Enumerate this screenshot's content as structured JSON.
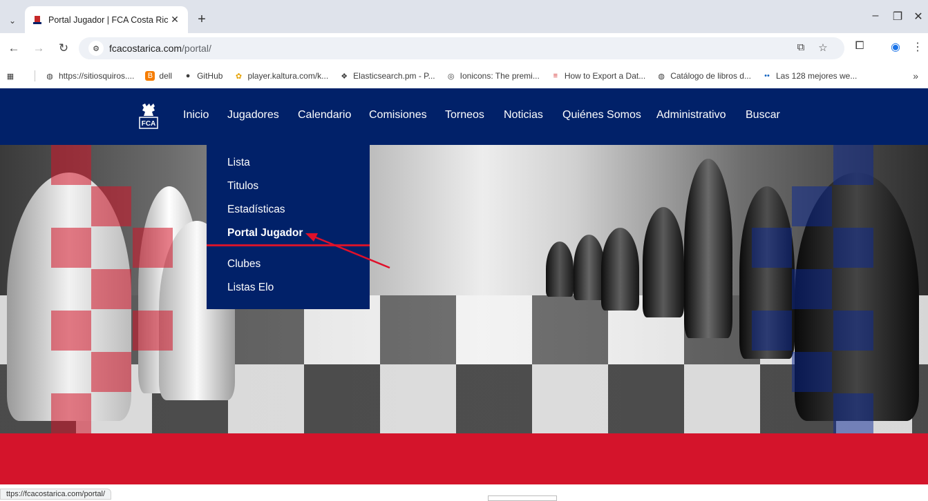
{
  "browser": {
    "tab_title": "Portal Jugador | FCA Costa Rica",
    "new_tab": "+",
    "tab_close": "✕",
    "url_host": "fcacostarica.com",
    "url_path": "/portal/",
    "status_url": "ttps://fcacostarica.com/portal/",
    "window_controls": [
      "–",
      "❐",
      "✕"
    ]
  },
  "bookmarks": [
    {
      "label": "https://sitiosquiros....",
      "icon": "globe-icon"
    },
    {
      "label": "dell",
      "icon": "blogger-icon"
    },
    {
      "label": "GitHub",
      "icon": "github-icon"
    },
    {
      "label": "player.kaltura.com/k...",
      "icon": "kaltura-icon"
    },
    {
      "label": "Elasticsearch.pm - P...",
      "icon": "elastic-icon"
    },
    {
      "label": "Ionicons: The premi...",
      "icon": "ionicons-icon"
    },
    {
      "label": "How to Export a Dat...",
      "icon": "flag-icon"
    },
    {
      "label": "Catálogo de libros d...",
      "icon": "globe-icon"
    },
    {
      "label": "Las 128 mejores we...",
      "icon": "dots-icon"
    }
  ],
  "site": {
    "nav": [
      "Inicio",
      "Jugadores",
      "Calendario",
      "Comisiones",
      "Torneos",
      "Noticias",
      "Quiénes Somos",
      "Administrativo",
      "Buscar"
    ],
    "dropdown": [
      "Lista",
      "Titulos",
      "Estadísticas",
      "Portal Jugador",
      "Clubes",
      "Listas Elo"
    ],
    "logo_text": "FCA",
    "colors": {
      "navy": "#012169",
      "red": "#d4142b"
    }
  }
}
